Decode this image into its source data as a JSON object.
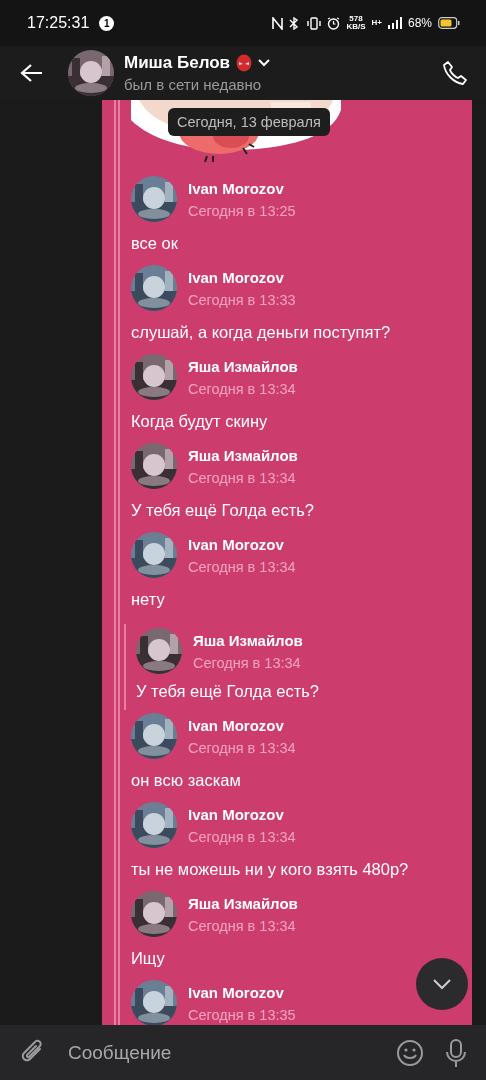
{
  "status_bar": {
    "time": "17:25:31",
    "notification_count": "1",
    "network_speed": "578",
    "speed_unit": "KB/S",
    "network_type": "H+",
    "battery": "68%"
  },
  "header": {
    "name": "Миша Белов",
    "status": "был в сети недавно"
  },
  "date_pill": "Сегодня, 13 февраля",
  "messages": [
    {
      "kind": "message",
      "author": "Ivan Morozov",
      "time": "Сегодня в 13:25",
      "text": "все ок"
    },
    {
      "kind": "message",
      "author": "Ivan Morozov",
      "time": "Сегодня в 13:33",
      "text": "слушай, а когда деньги поступят?"
    },
    {
      "kind": "message",
      "author": "Яша Измайлов",
      "time": "Сегодня в 13:34",
      "text": "Когда будут скину"
    },
    {
      "kind": "message",
      "author": "Яша Измайлов",
      "time": "Сегодня в 13:34",
      "text": "У тебя ещё Голда есть?"
    },
    {
      "kind": "message",
      "author": "Ivan Morozov",
      "time": "Сегодня в 13:34",
      "text": "нету"
    },
    {
      "kind": "quote",
      "author": "Яша Измайлов",
      "time": "Сегодня в 13:34",
      "text": "У тебя ещё Голда есть?"
    },
    {
      "kind": "message",
      "author": "Ivan Morozov",
      "time": "Сегодня в 13:34",
      "text": "он всю заскам"
    },
    {
      "kind": "message",
      "author": "Ivan Morozov",
      "time": "Сегодня в 13:34",
      "text": "ты не можешь ни у кого взять 480р?"
    },
    {
      "kind": "message",
      "author": "Яша Измайлов",
      "time": "Сегодня в 13:34",
      "text": "Ищу"
    },
    {
      "kind": "message",
      "author": "Ivan Morozov",
      "time": "Сегодня в 13:35"
    }
  ],
  "composer": {
    "placeholder": "Сообщение"
  }
}
